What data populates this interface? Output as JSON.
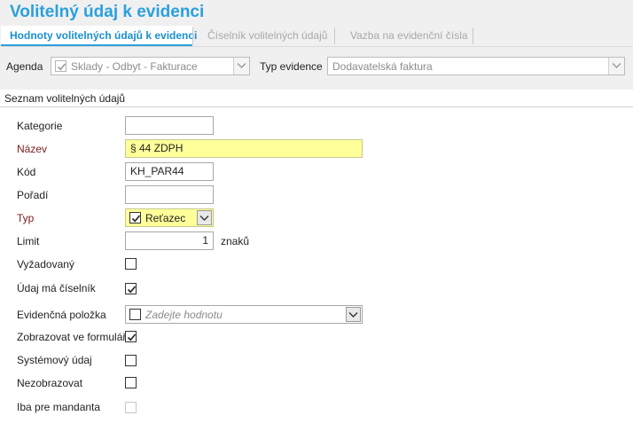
{
  "window": {
    "title": "Volitelný údaj k evidenci"
  },
  "tabs": [
    {
      "label": "Hodnoty volitelných údajů k evidenci",
      "active": true
    },
    {
      "label": "Číselník volitelných údajů",
      "active": false
    },
    {
      "label": "Vazba na evidenční čísla",
      "active": false
    }
  ],
  "toolbar": {
    "agenda_label": "Agenda",
    "agenda_value": "Sklady - Odbyt - Fakturace",
    "typ_evidence_label": "Typ evidence",
    "typ_evidence_value": "Dodavatelská faktura"
  },
  "section": {
    "title": "Seznam volitelných údajů"
  },
  "form": {
    "kategorie": {
      "label": "Kategorie",
      "value": ""
    },
    "nazev": {
      "label": "Název",
      "value": "§ 44 ZDPH"
    },
    "kod": {
      "label": "Kód",
      "value": "KH_PAR44"
    },
    "poradi": {
      "label": "Pořadí",
      "value": ""
    },
    "typ": {
      "label": "Typ",
      "value": "Reťazec",
      "checked": true
    },
    "limit": {
      "label": "Limit",
      "value": "1",
      "unit": "znaků"
    },
    "vyzadovany": {
      "label": "Vyžadovaný",
      "checked": false
    },
    "udaj_ciselnik": {
      "label": "Údaj má číselník",
      "checked": true
    },
    "evidencni_polozka": {
      "label": "Evidenčná položka",
      "placeholder": "Zadejte hodnotu",
      "checked": false
    },
    "zobrazovat": {
      "label": "Zobrazovat ve formuláři",
      "checked": true
    },
    "systemovy": {
      "label": "Systémový údaj",
      "checked": false
    },
    "nezobrazovat": {
      "label": "Nezobrazovat",
      "checked": false
    },
    "iba_mandanta": {
      "label": "Iba pre mandanta",
      "checked": false,
      "disabled": true
    }
  },
  "colors": {
    "accent": "#2aa0dc",
    "required_label": "#7a1c1c",
    "required_field": "#ffff99",
    "panel": "#f0f0f0"
  },
  "icons": {
    "check": "check-icon",
    "dropdown": "chevron-down-icon"
  }
}
